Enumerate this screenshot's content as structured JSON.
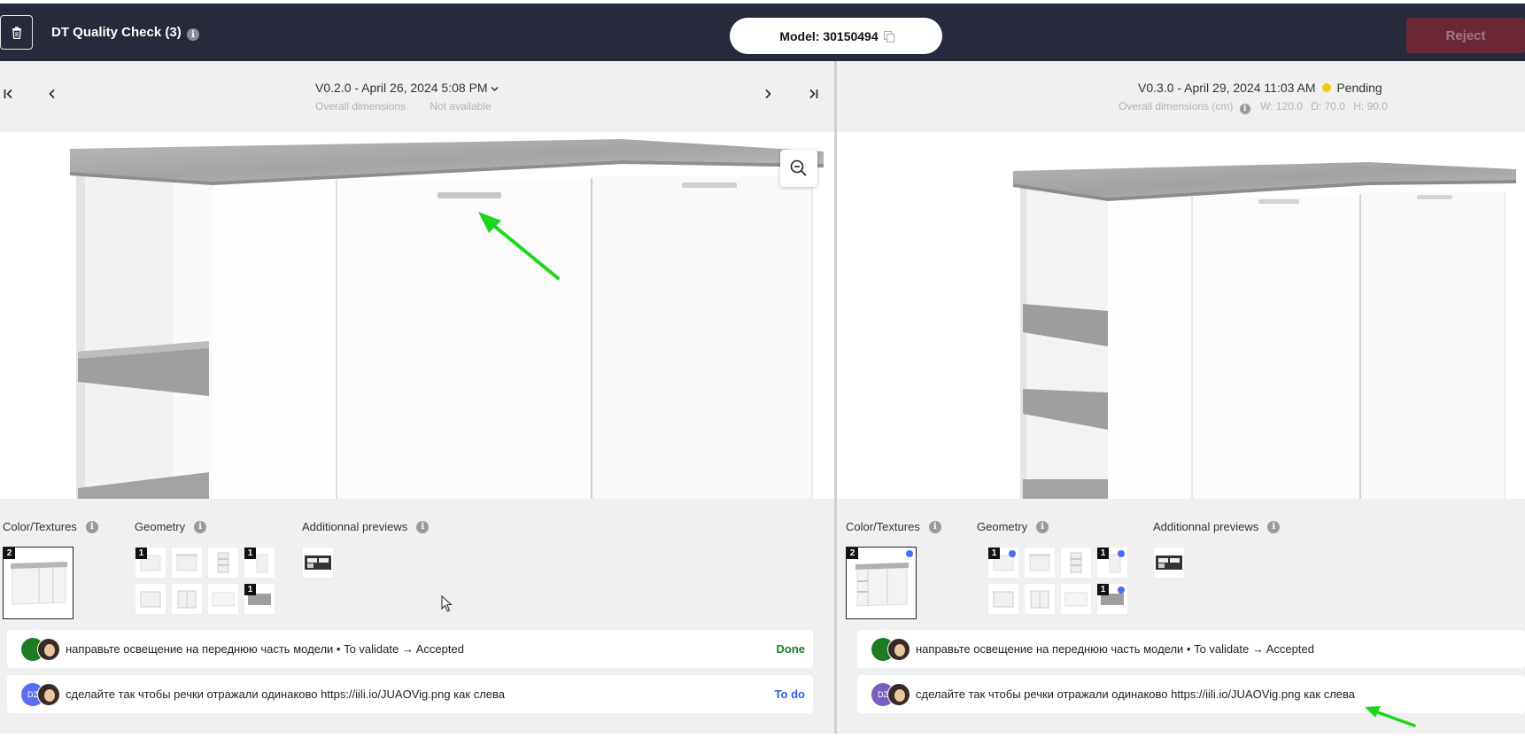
{
  "header": {
    "title": "DT Quality Check (3)",
    "model_label": "Model: 30150494",
    "reject_label": "Reject"
  },
  "icons": {
    "trash": "trash-icon",
    "info": "info-icon",
    "copy": "copy-icon",
    "zoom": "zoom-out-icon"
  },
  "info_glyph": "i",
  "left": {
    "version": "V0.2.0 - April 26, 2024 5:08 PM",
    "dims_label": "Overall dimensions",
    "dims_value": "Not available",
    "nav": {
      "first": "|<",
      "prev": "<",
      "next": ">",
      "last": ">|"
    },
    "sections": {
      "color": "Color/Textures",
      "geometry": "Geometry",
      "additional": "Additionnal previews"
    },
    "color_badge": "2",
    "geometry_badges": [
      "1",
      "",
      "",
      "1",
      "",
      "",
      "",
      "1"
    ],
    "comments": [
      {
        "avatar": "",
        "avatar_color": "#1d7b24",
        "text": "направьте освещение на переднюю часть модели • To validate → Accepted",
        "status": "Done"
      },
      {
        "avatar": "DZ",
        "avatar_color": "#5a6ef0",
        "text": "сделайте так чтобы речки отражали одинаково https://iili.io/JUAOVig.png как слева",
        "status": "To do"
      }
    ]
  },
  "right": {
    "version": "V0.3.0 - April 29, 2024 11:03 AM",
    "status": "Pending",
    "status_color": "#f2c811",
    "dims_label": "Overall dimensions (cm)",
    "dims_w": "W: 120.0",
    "dims_d": "D: 70.0",
    "dims_h": "H: 90.0",
    "sections": {
      "color": "Color/Textures",
      "geometry": "Geometry",
      "additional": "Additionnal previews"
    },
    "color_badge": "2",
    "geometry_badges": [
      "1",
      "",
      "",
      "1",
      "",
      "",
      "",
      "1"
    ],
    "comments": [
      {
        "avatar": "",
        "avatar_color": "#1d7b24",
        "text": "направьте освещение на переднюю часть модели • To validate → Accepted"
      },
      {
        "avatar": "DZ",
        "avatar_color": "#7a5fc0",
        "text": "сделайте так чтобы речки отражали одинаково https://iili.io/JUAOVig.png как слева"
      }
    ]
  },
  "colors": {
    "topbar": "#262a3a",
    "reject": "#6b2735",
    "done": "#1d7b24",
    "todo": "#2f5bea",
    "arrow": "#1fd61f"
  }
}
